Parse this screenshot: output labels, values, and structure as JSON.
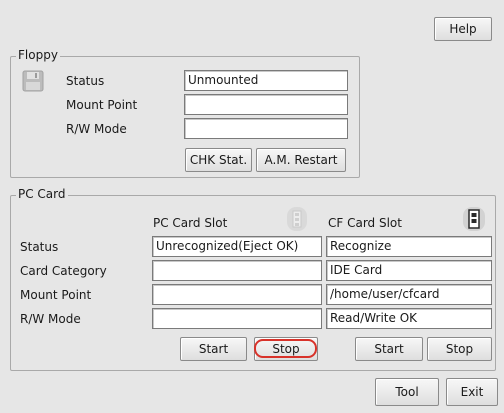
{
  "header": {
    "help_label": "Help"
  },
  "floppy": {
    "title": "Floppy",
    "status_label": "Status",
    "mount_point_label": "Mount Point",
    "rw_mode_label": "R/W Mode",
    "status_value": "Unmounted",
    "mount_point_value": "",
    "rw_mode_value": "",
    "chk_stat_label": "CHK Stat.",
    "am_restart_label": "A.M. Restart"
  },
  "pc_card": {
    "title": "PC Card",
    "pc_slot_header": "PC Card Slot",
    "cf_slot_header": "CF Card Slot",
    "row_labels": {
      "status": "Status",
      "card_category": "Card Category",
      "mount_point": "Mount Point",
      "rw_mode": "R/W Mode"
    },
    "pc_slot": {
      "status": "Unrecognized(Eject OK)",
      "card_category": "",
      "mount_point": "",
      "rw_mode": "",
      "start_label": "Start",
      "stop_label": "Stop"
    },
    "cf_slot": {
      "status": "Recognize",
      "card_category": "IDE Card",
      "mount_point": "/home/user/cfcard",
      "rw_mode": "Read/Write OK",
      "start_label": "Start",
      "stop_label": "Stop"
    }
  },
  "footer": {
    "tool_label": "Tool",
    "exit_label": "Exit"
  },
  "highlight_color": "#d8322a",
  "icons": [
    "floppy-disk-icon",
    "pc-card-slot-icon",
    "cf-card-slot-icon"
  ]
}
